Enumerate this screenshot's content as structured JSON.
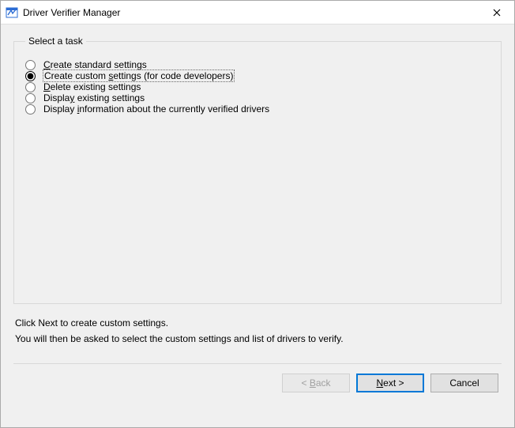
{
  "window": {
    "title": "Driver Verifier Manager"
  },
  "group": {
    "legend": "Select a task",
    "options": [
      {
        "pre": "",
        "accel": "C",
        "post": "reate standard settings"
      },
      {
        "pre": "Create custom ",
        "accel": "s",
        "post": "ettings (for code developers)"
      },
      {
        "pre": "",
        "accel": "D",
        "post": "elete existing settings"
      },
      {
        "pre": "Displa",
        "accel": "y",
        "post": " existing settings"
      },
      {
        "pre": "Display ",
        "accel": "i",
        "post": "nformation about the currently verified drivers"
      }
    ],
    "selected_index": 1
  },
  "description": {
    "line1": "Click Next to create custom settings.",
    "line2": "You will then be asked to select the custom settings and list of drivers to verify."
  },
  "buttons": {
    "back_pre": "< ",
    "back_accel": "B",
    "back_post": "ack",
    "next_accel": "N",
    "next_post": "ext >",
    "cancel": "Cancel"
  }
}
